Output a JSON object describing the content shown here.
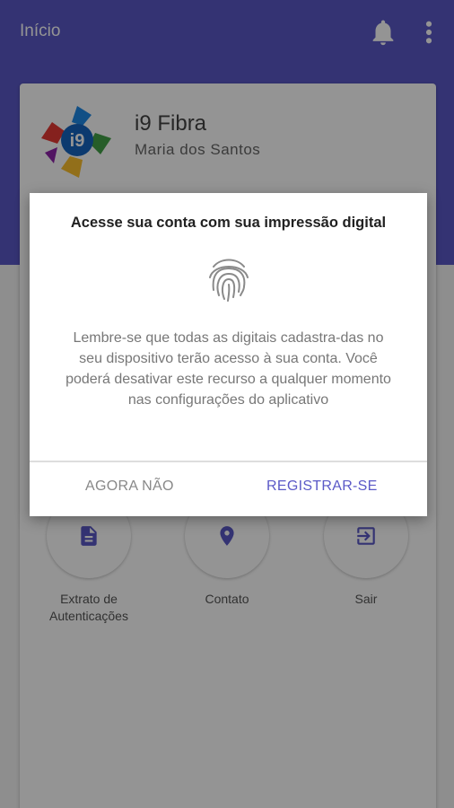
{
  "appbar": {
    "title": "Início",
    "icons": {
      "notifications": "bell-icon",
      "menu": "more-vert-icon"
    }
  },
  "account": {
    "company": "i9 Fibra",
    "user": "Maria dos Santos",
    "logo_text": "i9"
  },
  "actions": [
    {
      "label": "Extrato de Autenticações",
      "icon": "document-icon"
    },
    {
      "label": "Contato",
      "icon": "location-pin-icon"
    },
    {
      "label": "Sair",
      "icon": "exit-icon"
    }
  ],
  "dialog": {
    "title": "Acesse sua conta com sua impressão digital",
    "icon": "fingerprint-icon",
    "message": "Lembre-se que todas as digitais cadastra-das no seu dispositivo terão acesso à sua conta. Você poderá desativar este recurso a qualquer momento nas configurações do aplicativo",
    "dismiss_label": "AGORA NÃO",
    "confirm_label": "REGISTRAR-SE"
  },
  "colors": {
    "primary": "#5b59c7",
    "background": "#f5f5f5",
    "surface": "#ffffff"
  }
}
